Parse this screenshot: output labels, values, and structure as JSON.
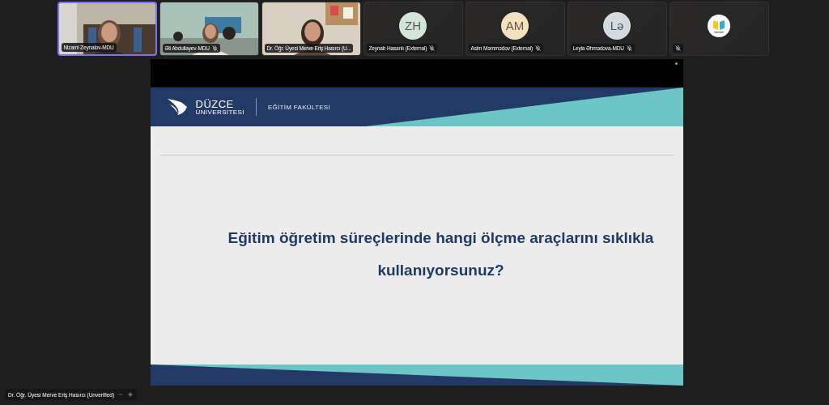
{
  "participants": [
    {
      "kind": "video",
      "name": "Nizami Zeynalov-MDU",
      "muted": false,
      "selected": true
    },
    {
      "kind": "video",
      "name": "Əli Abdullayev-MDU",
      "muted": true,
      "selected": false
    },
    {
      "kind": "video",
      "name": "Dr. Öğr. Üyesi Merve Eriş Hasırcı (U...",
      "muted": false,
      "selected": false
    },
    {
      "kind": "avatar",
      "name": "Zeynab Hasanlı (External)",
      "initials": "ZH",
      "color": "#d3e4d8",
      "muted": true,
      "selected": false
    },
    {
      "kind": "avatar",
      "name": "Asim Məmmədov (External)",
      "initials": "AM",
      "color": "#f3e2bf",
      "muted": true,
      "selected": false
    },
    {
      "kind": "avatar",
      "name": "Leyla Əhmədova-MDU",
      "initials": "Lə",
      "color": "#d2dbe1",
      "muted": true,
      "selected": false
    },
    {
      "kind": "logo",
      "muted": true,
      "selected": false
    }
  ],
  "slide": {
    "brand_top": "DÜZCE",
    "brand_bottom": "ÜNİVERSİTESİ",
    "faculty": "EĞİTİM FAKÜLTESİ",
    "question": "Eğitim öğretim süreçlerinde hangi ölçme araçlarını sıklıkla kullanıyorsunuz?"
  },
  "speaker_label": {
    "name": "Dr. Öğr. Üyesi Merve Eriş Hasırcı (Unverified)"
  }
}
